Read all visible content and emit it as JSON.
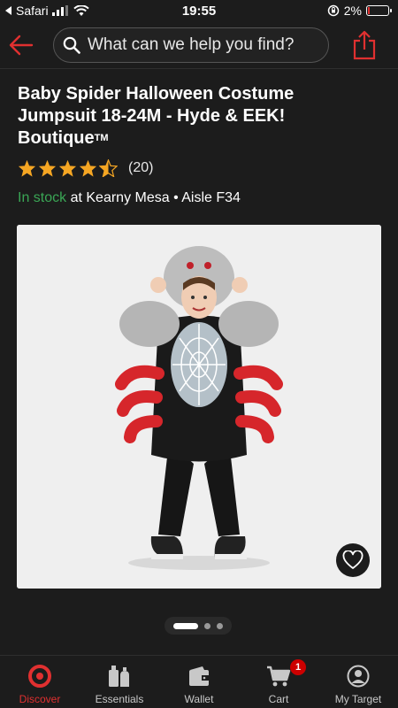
{
  "status_bar": {
    "back_app": "Safari",
    "time": "19:55",
    "battery": "2%",
    "battery_level": 0.02
  },
  "header": {
    "search_placeholder": "What can we help you find?"
  },
  "product": {
    "title": "Baby Spider Halloween Costume Jumpsuit 18-24M - Hyde & EEK! Boutique",
    "trademark": "TM",
    "rating": 4.5,
    "rating_count": "(20)",
    "stock_status": "In stock",
    "stock_location": " at Kearny Mesa • Aisle F34"
  },
  "carousel": {
    "total": 3,
    "active_index": 0
  },
  "tabs": [
    {
      "label": "Discover",
      "icon": "target-logo-icon",
      "active": true
    },
    {
      "label": "Essentials",
      "icon": "essentials-icon",
      "active": false
    },
    {
      "label": "Wallet",
      "icon": "wallet-icon",
      "active": false
    },
    {
      "label": "Cart",
      "icon": "cart-icon",
      "active": false,
      "badge": "1"
    },
    {
      "label": "My Target",
      "icon": "account-icon",
      "active": false
    }
  ],
  "colors": {
    "accent": "#e03030",
    "in_stock": "#3aa655",
    "star": "#f5a623",
    "background": "#1c1c1c"
  }
}
